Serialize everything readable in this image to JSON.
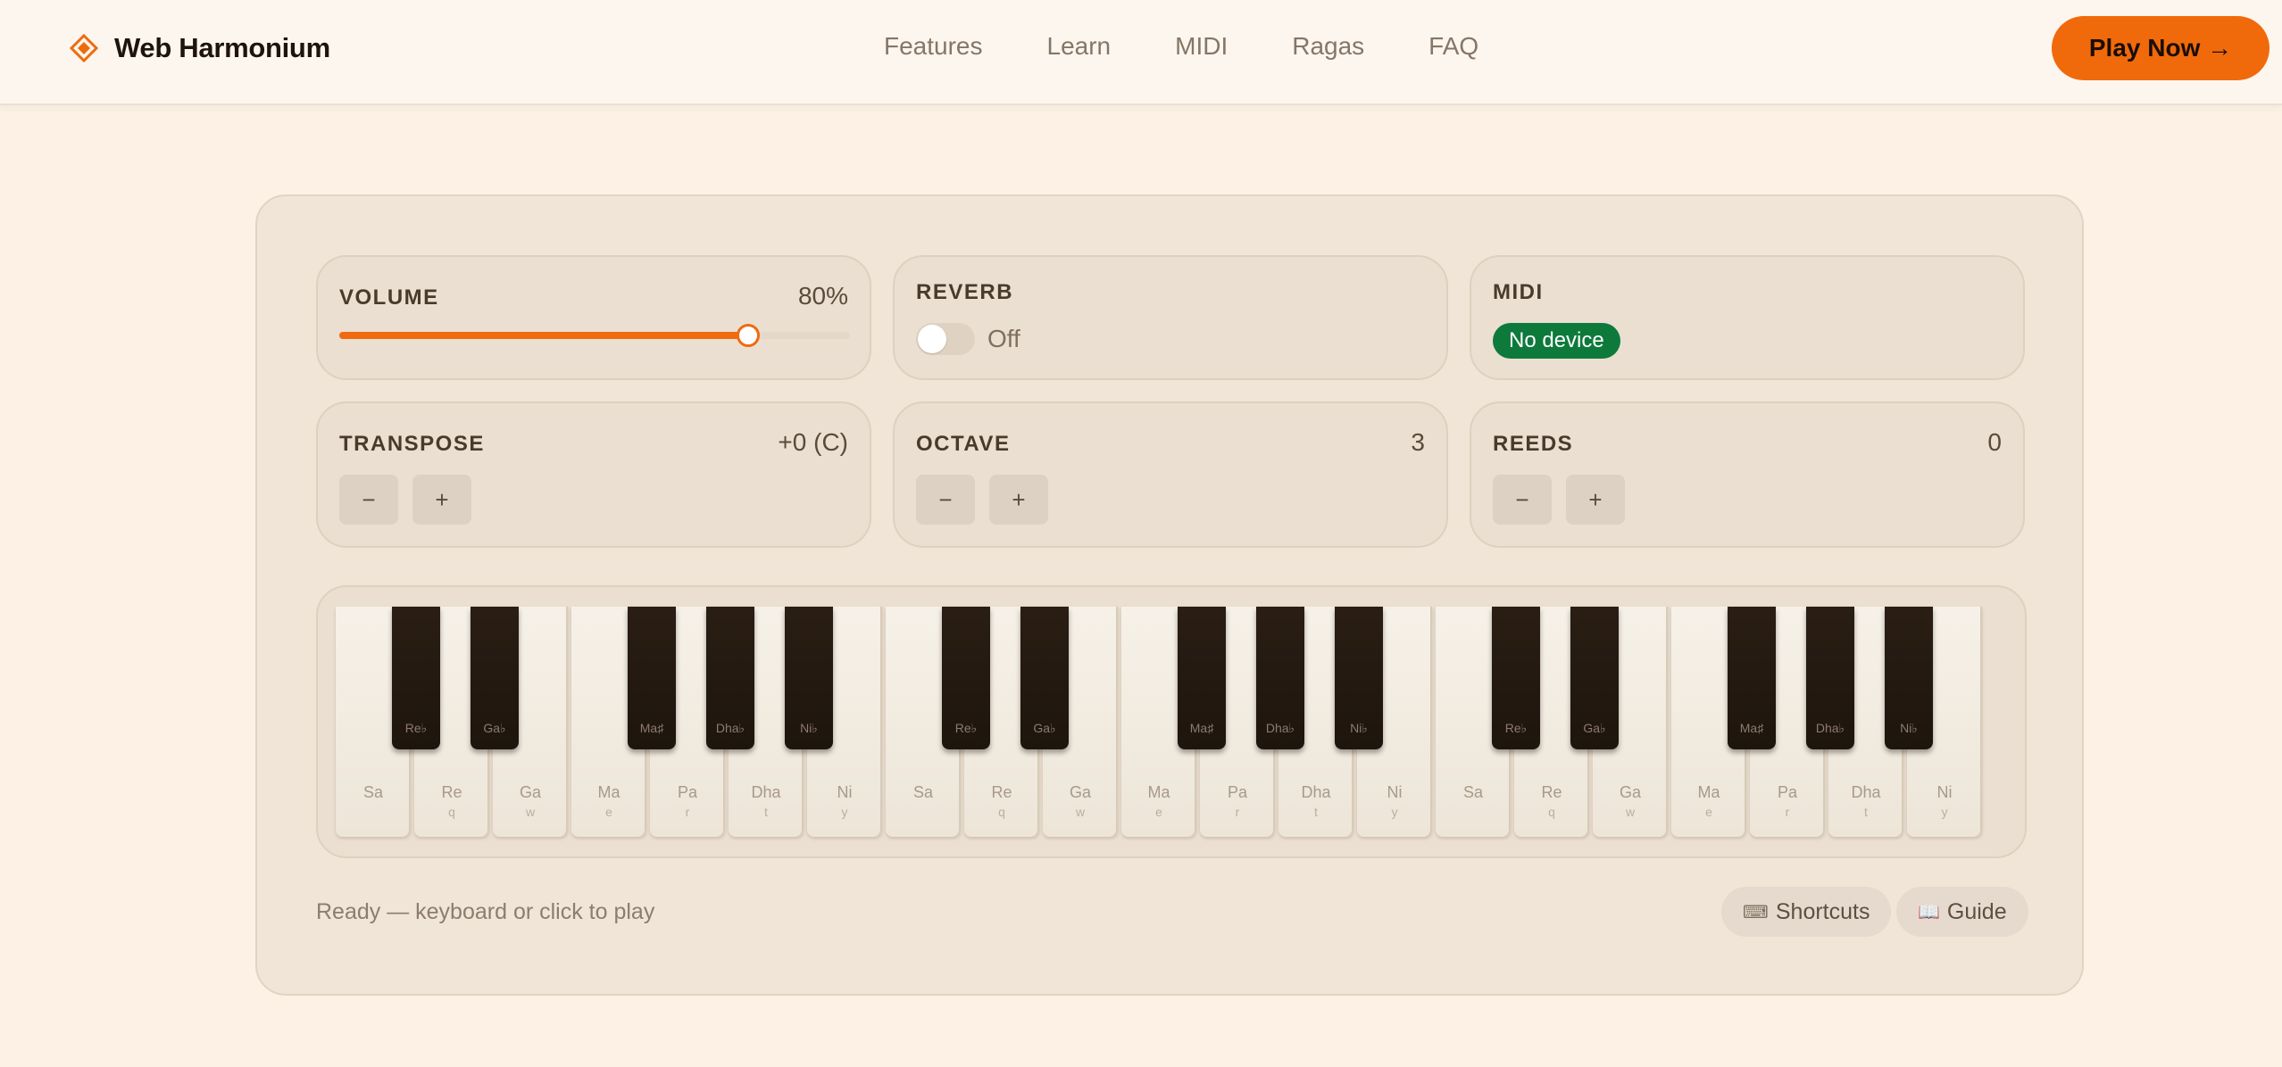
{
  "brand": {
    "name": "Web Harmonium",
    "icon": "diamond-icon",
    "accent": "#f06a0c"
  },
  "nav": [
    {
      "label": "Features"
    },
    {
      "label": "Learn"
    },
    {
      "label": "MIDI"
    },
    {
      "label": "Ragas"
    },
    {
      "label": "FAQ"
    }
  ],
  "cta": {
    "label": "Play Now →"
  },
  "controls": {
    "volume": {
      "title": "VOLUME",
      "value": "80%",
      "level": 0.8
    },
    "reverb": {
      "title": "REVERB",
      "state": "Off"
    },
    "midi": {
      "title": "MIDI",
      "status": "No device",
      "status_color": "#0d7a3c"
    },
    "transpose": {
      "title": "TRANSPOSE",
      "value": "+0 (C)",
      "minus": "−",
      "plus": "+"
    },
    "octave": {
      "title": "OCTAVE",
      "value": "3",
      "minus": "−",
      "plus": "+"
    },
    "reeds": {
      "title": "REEDS",
      "value": "0",
      "minus": "−",
      "plus": "+"
    }
  },
  "keyboard": {
    "white_keys": [
      {
        "note": "Sa",
        "key": ""
      },
      {
        "note": "Re",
        "key": "q"
      },
      {
        "note": "Ga",
        "key": "w"
      },
      {
        "note": "Ma",
        "key": "e"
      },
      {
        "note": "Pa",
        "key": "r"
      },
      {
        "note": "Dha",
        "key": "t"
      },
      {
        "note": "Ni",
        "key": "y"
      },
      {
        "note": "Sa",
        "key": ""
      },
      {
        "note": "Re",
        "key": "q"
      },
      {
        "note": "Ga",
        "key": "w"
      },
      {
        "note": "Ma",
        "key": "e"
      },
      {
        "note": "Pa",
        "key": "r"
      },
      {
        "note": "Dha",
        "key": "t"
      },
      {
        "note": "Ni",
        "key": "y"
      },
      {
        "note": "Sa",
        "key": ""
      },
      {
        "note": "Re",
        "key": "q"
      },
      {
        "note": "Ga",
        "key": "w"
      },
      {
        "note": "Ma",
        "key": "e"
      },
      {
        "note": "Pa",
        "key": "r"
      },
      {
        "note": "Dha",
        "key": "t"
      },
      {
        "note": "Ni",
        "key": "y"
      }
    ],
    "black_keys": [
      "Re♭",
      "Ga♭",
      "Ma♯",
      "Dha♭",
      "Ni♭",
      "Re♭",
      "Ga♭",
      "Ma♯",
      "Dha♭",
      "Ni♭",
      "Re♭",
      "Ga♭",
      "Ma♯",
      "Dha♭",
      "Ni♭"
    ]
  },
  "footer": {
    "status": "Ready — keyboard or click to play",
    "shortcuts": {
      "icon": "keyboard-icon",
      "glyph": "⌨",
      "label": "Shortcuts"
    },
    "guide": {
      "icon": "book-icon",
      "glyph": "📖",
      "label": "Guide"
    }
  }
}
